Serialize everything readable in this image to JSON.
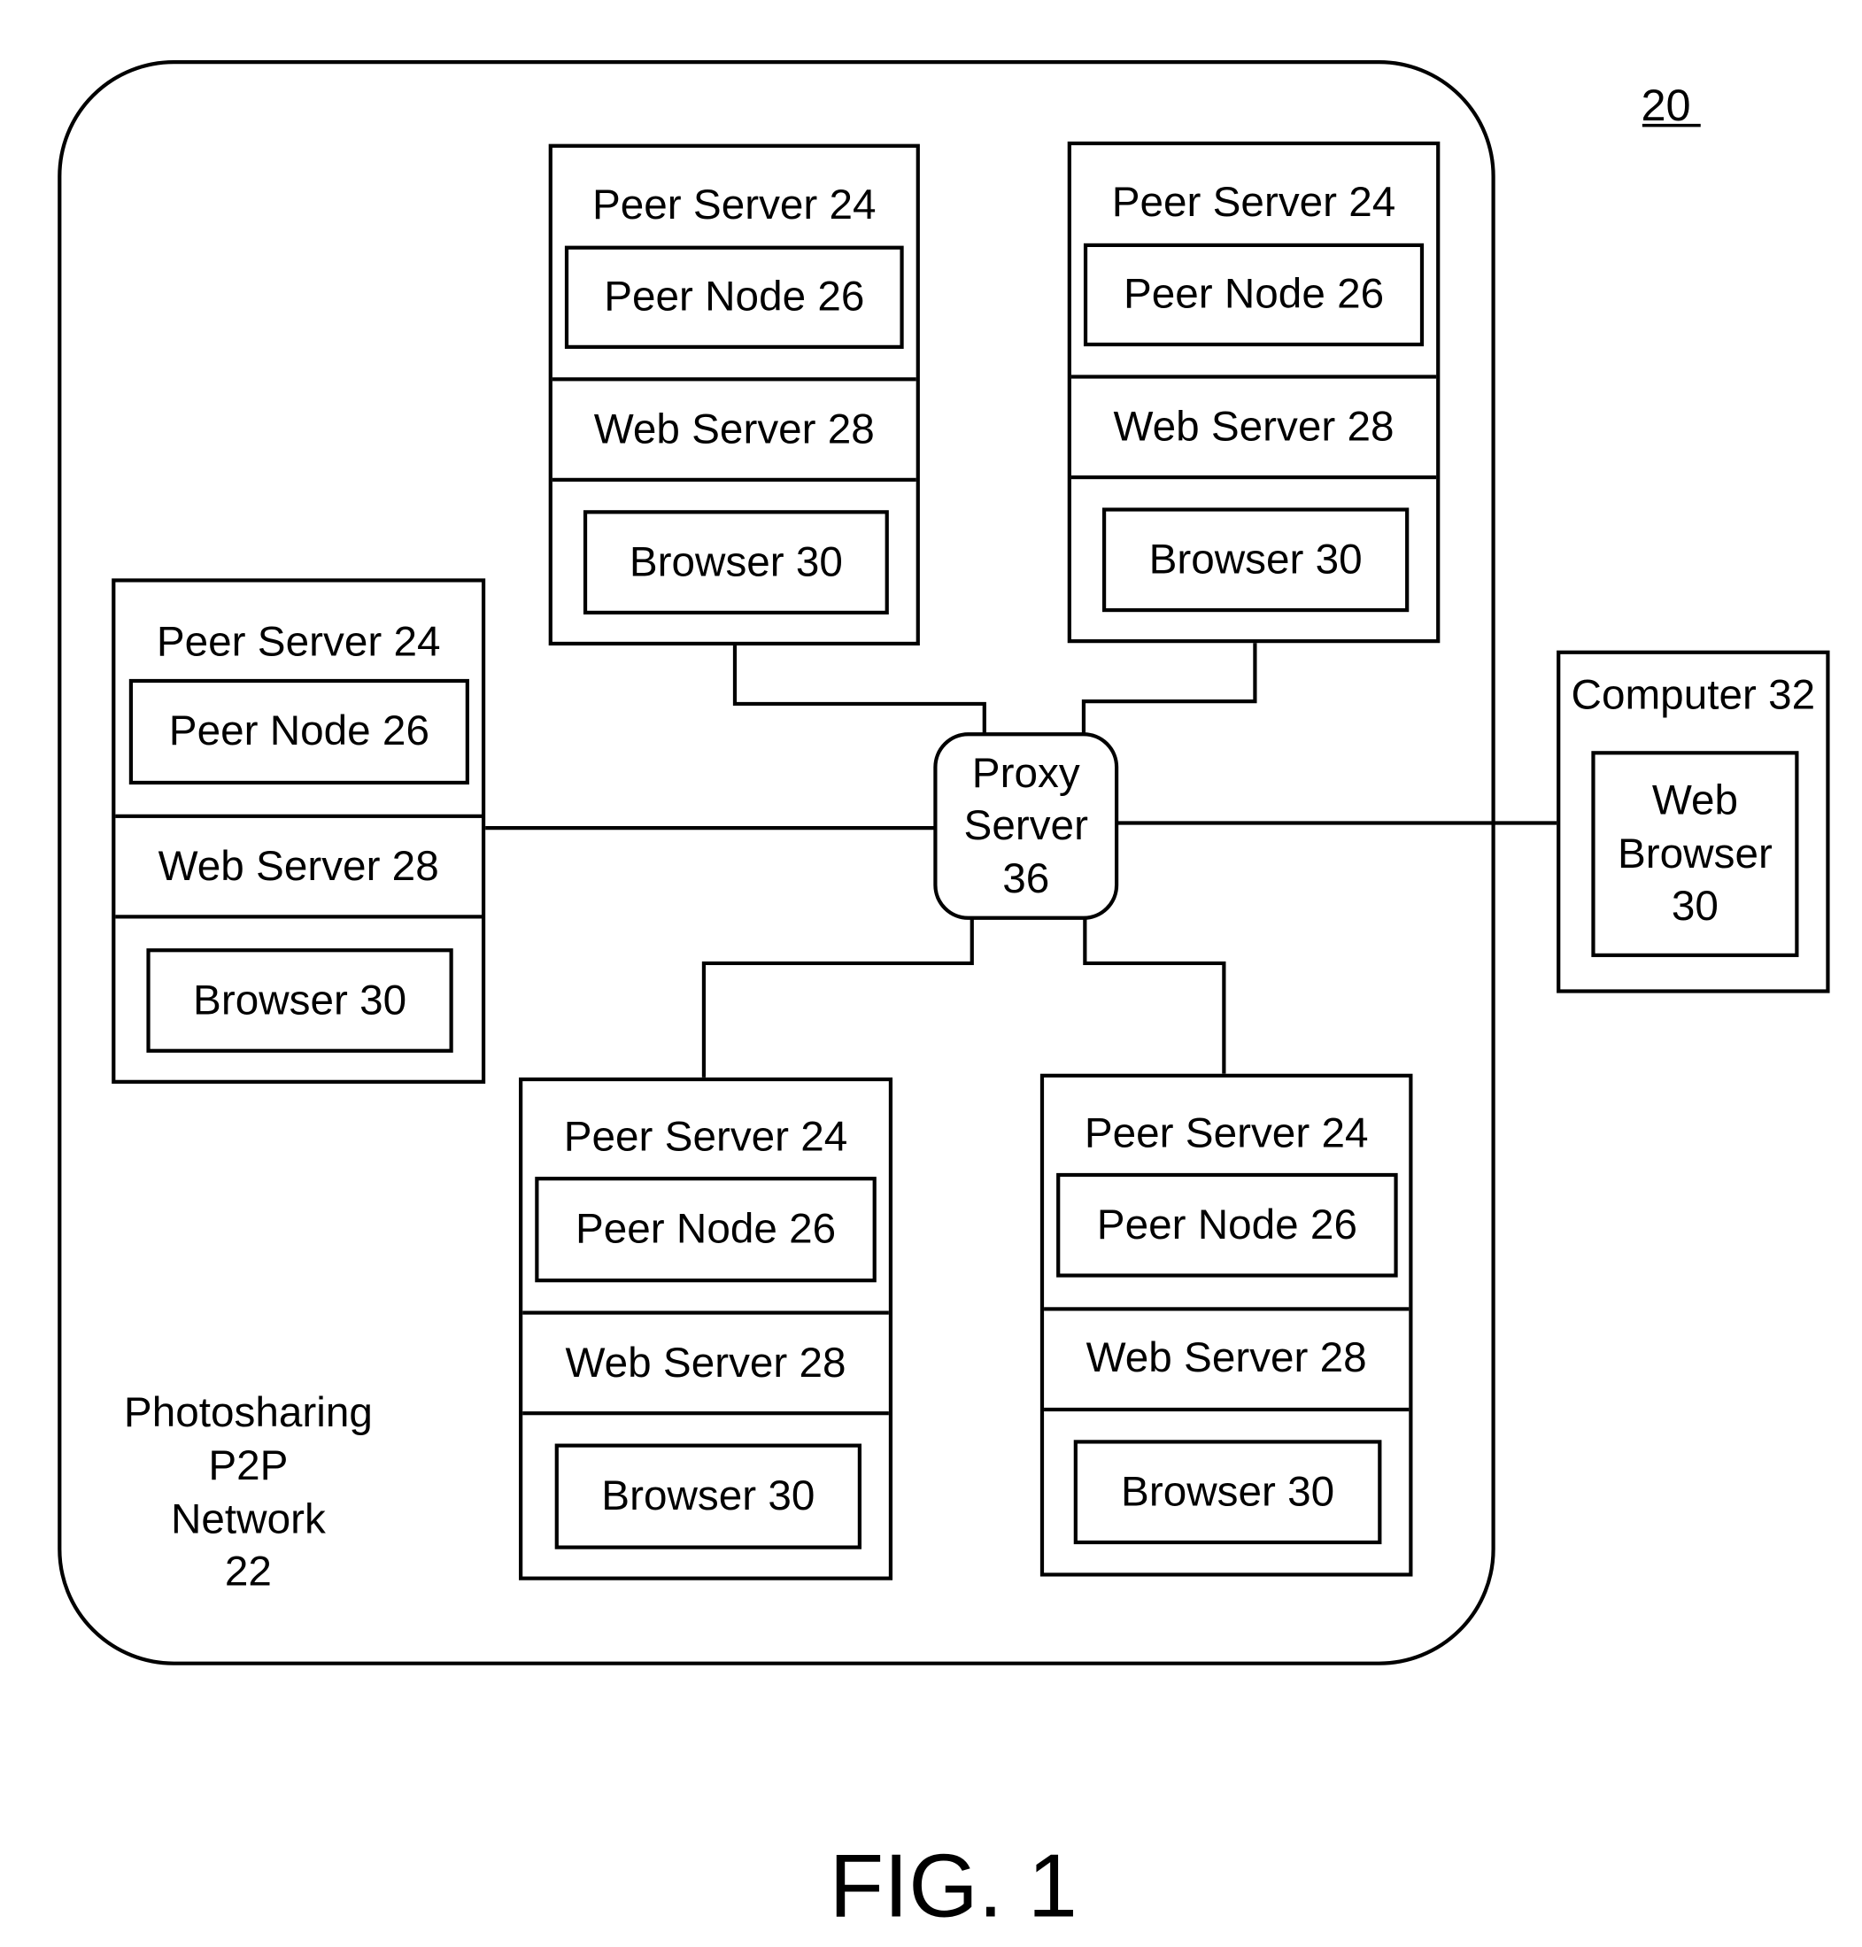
{
  "figure": {
    "reference_number": "20",
    "caption": "FIG. 1"
  },
  "network": {
    "label_lines": [
      "Photosharing",
      "P2P",
      "Network",
      "22"
    ]
  },
  "peer_servers": [
    {
      "position": "top-left",
      "title": "Peer Server 24",
      "peer_node": "Peer Node 26",
      "web_server": "Web Server 28",
      "browser": "Browser 30"
    },
    {
      "position": "top-right",
      "title": "Peer Server 24",
      "peer_node": "Peer Node 26",
      "web_server": "Web Server 28",
      "browser": "Browser 30"
    },
    {
      "position": "left",
      "title": "Peer Server 24",
      "peer_node": "Peer Node 26",
      "web_server": "Web Server 28",
      "browser": "Browser 30"
    },
    {
      "position": "bottom-left",
      "title": "Peer Server 24",
      "peer_node": "Peer Node 26",
      "web_server": "Web Server 28",
      "browser": "Browser 30"
    },
    {
      "position": "bottom-right",
      "title": "Peer Server 24",
      "peer_node": "Peer Node 26",
      "web_server": "Web Server 28",
      "browser": "Browser 30"
    }
  ],
  "proxy": {
    "label_lines": [
      "Proxy",
      "Server",
      "36"
    ]
  },
  "computer": {
    "title": "Computer 32",
    "browser_lines": [
      "Web",
      "Browser",
      "30"
    ]
  },
  "connections": [
    {
      "from": "peer-server-top-left",
      "to": "proxy-server"
    },
    {
      "from": "peer-server-top-right",
      "to": "proxy-server"
    },
    {
      "from": "peer-server-left",
      "to": "proxy-server"
    },
    {
      "from": "peer-server-bottom-left",
      "to": "proxy-server"
    },
    {
      "from": "peer-server-bottom-right",
      "to": "proxy-server"
    },
    {
      "from": "proxy-server",
      "to": "computer"
    }
  ]
}
